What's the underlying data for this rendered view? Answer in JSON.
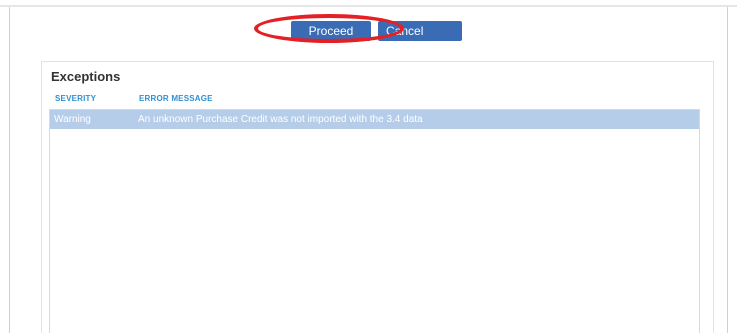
{
  "actions": {
    "proceed_label": "Proceed",
    "cancel_label": "Cancel"
  },
  "exceptions": {
    "title": "Exceptions",
    "columns": [
      "SEVERITY",
      "ERROR MESSAGE"
    ],
    "rows": [
      {
        "severity": "Warning",
        "message": "An unknown Purchase Credit was not imported with the 3.4 data"
      }
    ]
  },
  "colors": {
    "button_bg": "#3a6cb5",
    "highlight_annotation": "#e41f25",
    "column_header": "#2f8fd3",
    "selected_row": "#b6cdea"
  }
}
